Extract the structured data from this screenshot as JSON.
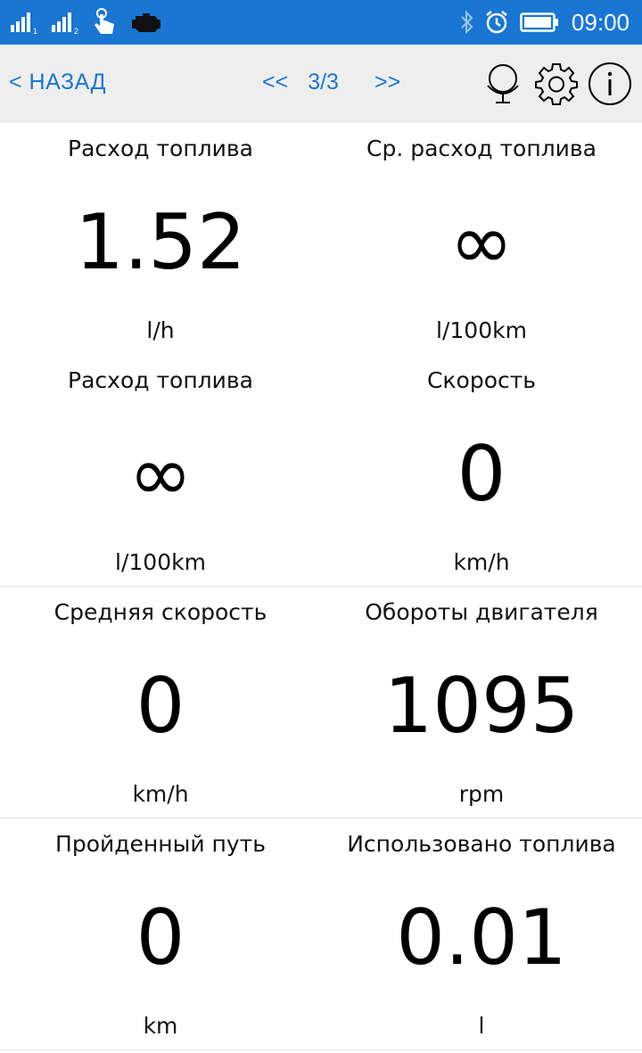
{
  "status_bar": {
    "sim1_index": "1",
    "sim2_index": "2",
    "time": "09:00",
    "icons": [
      "signal-sim1-icon",
      "signal-sim2-icon",
      "touch-icon",
      "engine-icon",
      "bluetooth-icon",
      "alarm-icon",
      "battery-icon"
    ]
  },
  "toolbar": {
    "back_label": "< НАЗАД",
    "prev_label": "<<",
    "page_indicator": "3/3",
    "next_label": ">>",
    "icons": [
      "globe-icon",
      "gear-icon",
      "info-icon"
    ]
  },
  "tiles": [
    {
      "label": "Расход топлива",
      "value": "1.52",
      "unit": "l/h"
    },
    {
      "label": "Ср. расход топлива",
      "value": "∞",
      "unit": "l/100km"
    },
    {
      "label": "Расход топлива",
      "value": "∞",
      "unit": "l/100km"
    },
    {
      "label": "Скорость",
      "value": "0",
      "unit": "km/h"
    },
    {
      "label": "Средняя скорость",
      "value": "0",
      "unit": "km/h"
    },
    {
      "label": "Обороты двигателя",
      "value": "1095",
      "unit": "rpm"
    },
    {
      "label": "Пройденный путь",
      "value": "0",
      "unit": "km"
    },
    {
      "label": "Использовано топлива",
      "value": "0.01",
      "unit": "l"
    }
  ],
  "colors": {
    "status_bar": "#1976d2",
    "accent": "#1976d2",
    "toolbar_bg": "#eeeeee"
  }
}
